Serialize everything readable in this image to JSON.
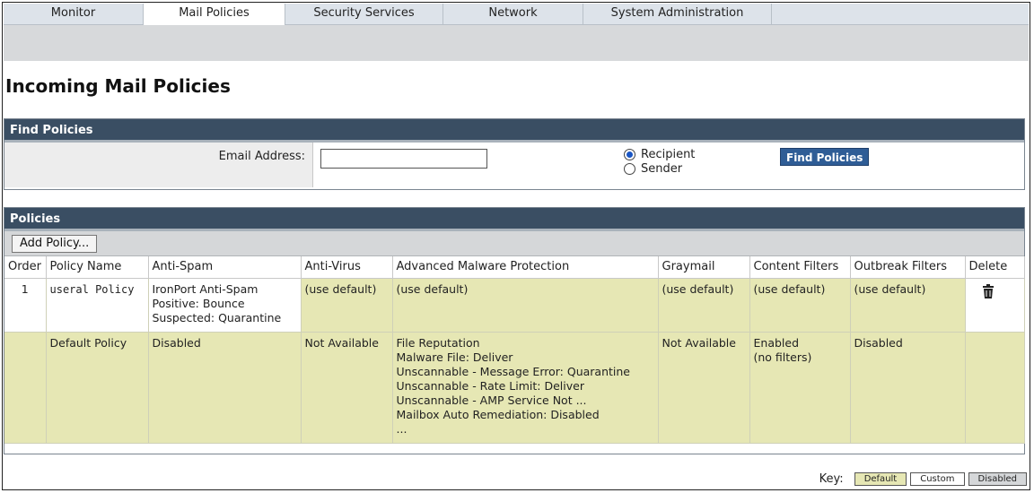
{
  "nav": {
    "tabs": [
      {
        "label": "Monitor"
      },
      {
        "label": "Mail Policies"
      },
      {
        "label": "Security Services"
      },
      {
        "label": "Network"
      },
      {
        "label": "System Administration"
      }
    ],
    "active": "Mail Policies"
  },
  "page": {
    "title": "Incoming Mail Policies"
  },
  "find_policies": {
    "header": "Find Policies",
    "email_label": "Email Address:",
    "email_value": "",
    "radio_recipient": "Recipient",
    "radio_sender": "Sender",
    "selected": "Recipient",
    "button": "Find Policies"
  },
  "policies": {
    "header": "Policies",
    "add_button": "Add Policy...",
    "columns": [
      "Order",
      "Policy Name",
      "Anti-Spam",
      "Anti-Virus",
      "Advanced Malware Protection",
      "Graymail",
      "Content Filters",
      "Outbreak Filters",
      "Delete"
    ],
    "rows": [
      {
        "order": "1",
        "name": "useral Policy",
        "anti_spam": [
          "IronPort Anti-Spam",
          "Positive: Bounce",
          "Suspected: Quarantine"
        ],
        "anti_virus": "(use default)",
        "amp": "(use default)",
        "graymail": "(use default)",
        "content_filters": "(use default)",
        "outbreak_filters": "(use default)",
        "delete_icon": "trash-icon"
      },
      {
        "order": "",
        "name": "Default Policy",
        "anti_spam": [
          "Disabled"
        ],
        "anti_virus": "Not Available",
        "amp": [
          "File Reputation",
          "Malware File: Deliver",
          "Unscannable - Message Error: Quarantine",
          "Unscannable - Rate Limit: Deliver",
          "Unscannable - AMP Service Not ...",
          "Mailbox Auto Remediation: Disabled",
          "..."
        ],
        "graymail": "Not Available",
        "content_filters": [
          "Enabled",
          "(no filters)"
        ],
        "outbreak_filters": "Disabled"
      }
    ]
  },
  "key": {
    "label": "Key:",
    "items": [
      "Default",
      "Custom",
      "Disabled"
    ]
  },
  "colors": {
    "header_bg": "#3a4e63",
    "default_row": "#e6e7b4",
    "button_blue": "#2f5d96"
  }
}
